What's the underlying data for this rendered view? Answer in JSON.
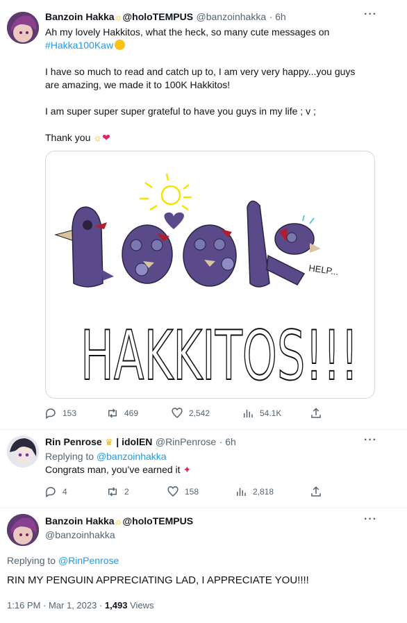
{
  "tweet1": {
    "display_name": "Banzoin Hakka",
    "handle_badge": "@holoTEMPUS",
    "handle": "@banzoinhakka",
    "time": "· 6h",
    "line1": "Ah my lovely Hakkitos, what the heck, so many cute messages on",
    "hashtag": "#Hakka100Kaw",
    "para2_line1": "I have so much to read and catch up to, I am very very happy...you guys",
    "para2_line2": "are amazing, we made it to 100K Hakkitos!",
    "para3": "I am super super super grateful to have you guys in my life ; v ;",
    "para4": "Thank you",
    "media_words": {
      "top": "100K",
      "bottom": "HAKKITOS!!!",
      "help": "HELP..."
    },
    "stats": {
      "replies": "153",
      "retweets": "469",
      "likes": "2,542",
      "views": "54.1K"
    }
  },
  "tweet2": {
    "display_name": "Rin Penrose",
    "suffix": "| idolEN",
    "handle": "@RinPenrose",
    "time": "· 6h",
    "replying_label": "Replying to",
    "replying_to": "@banzoinhakka",
    "text": "Congrats man, you’ve earned it",
    "stats": {
      "replies": "4",
      "retweets": "2",
      "likes": "158",
      "views": "2,818"
    }
  },
  "tweet3": {
    "display_name": "Banzoin Hakka",
    "handle_badge": "@holoTEMPUS",
    "handle": "@banzoinhakka",
    "replying_label": "Replying to",
    "replying_to": "@RinPenrose",
    "text": "RIN MY PENGUIN APPRECIATING LAD, I APPRECIATE YOU!!!!",
    "timestamp": "1:16 PM · Mar 1, 2023 ·",
    "views_count": "1,493",
    "views_label": "Views"
  },
  "icons": [
    "sun-icon",
    "heart-icon",
    "crown-icon",
    "party-popper-icon",
    "blush-emoji-icon",
    "more-icon",
    "reply-icon",
    "retweet-icon",
    "like-icon",
    "views-icon",
    "share-icon"
  ],
  "colors": {
    "link": "#1d9bf0",
    "muted": "#536471",
    "divider": "#eff3f4",
    "heart": "#f91880",
    "penguin": "#5b4a8a"
  }
}
